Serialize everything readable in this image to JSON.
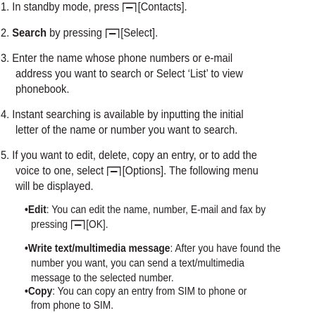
{
  "steps": [
    {
      "num": "1.",
      "pre": "In standby mode, press",
      "key": "[Contacts]."
    },
    {
      "num": "2.",
      "bold": "Search",
      "pre": " by pressing",
      "key": "[Select]."
    },
    {
      "num": "3.",
      "lines": [
        "Enter the name whose phone numbers or e-mail",
        "address you want to search or Select ‘List’ to view",
        "phonebook."
      ]
    },
    {
      "num": "4.",
      "lines": [
        "Instant searching is available by inputting the initial",
        "letter of the name or number you want to search."
      ]
    },
    {
      "num": "5.",
      "lines": [
        "If you want to edit, delete, copy an entry, or to add the",
        "voice to one, select",
        "[Options]. The following menu",
        "will be displayed."
      ]
    }
  ],
  "bullets": [
    {
      "term": "Edit",
      "line1": ": You can edit the name, number, E-mail and fax by",
      "pre2": "pressing",
      "key2": "[OK]."
    },
    {
      "term": "Write text/multimedia message",
      "line1": ": After you have found the",
      "line2": "number you want, you can send a text/multimedia",
      "line3": "message to the selected number."
    },
    {
      "term": "Copy",
      "line1": ": You can copy an entry from SIM to phone or",
      "line2": "from phone to SIM."
    }
  ],
  "icons": {
    "softkey": "softkey-icon"
  },
  "colors": {
    "text": "#231f20",
    "background": "#ffffff"
  }
}
